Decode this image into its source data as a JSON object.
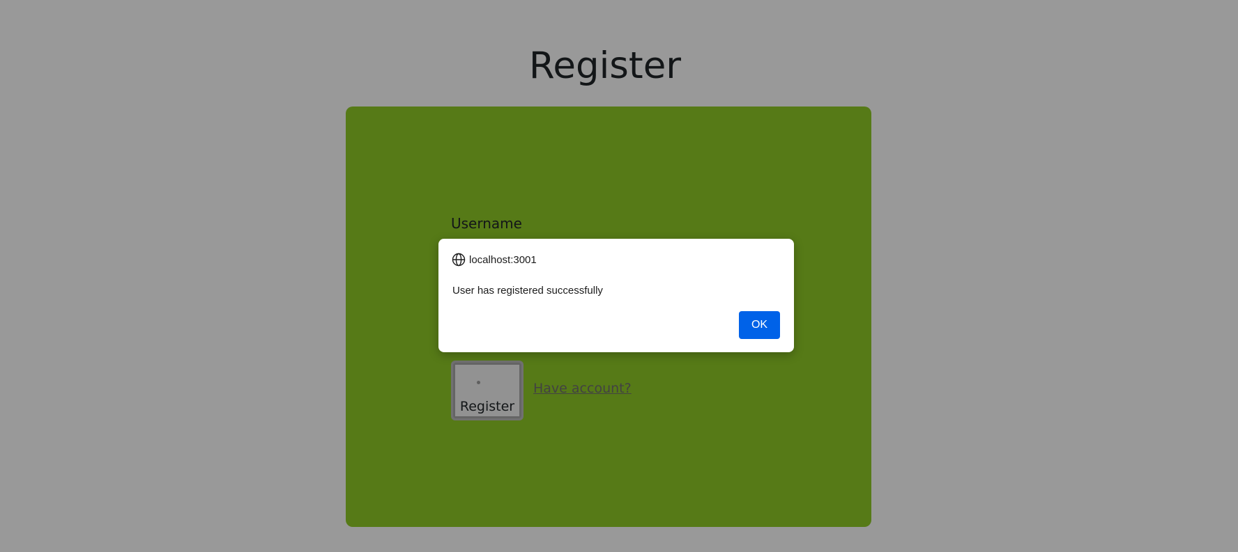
{
  "page": {
    "title": "Register"
  },
  "form": {
    "username_label": "Username",
    "register_label": "Register",
    "have_account_link": "Have account?",
    "card_color": "#8fcb27"
  },
  "dialog": {
    "origin": "localhost:3001",
    "origin_icon": "globe-icon",
    "message": "User has registered successfully",
    "ok_label": "OK",
    "button_color": "#0062e8"
  }
}
